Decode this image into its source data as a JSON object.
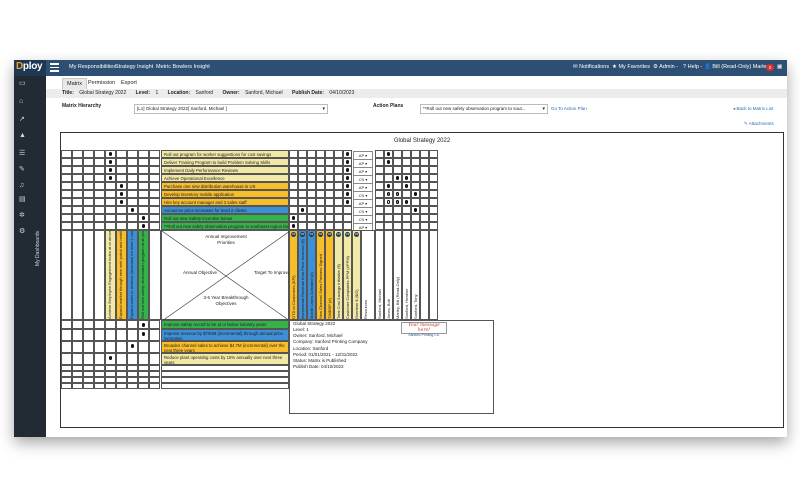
{
  "app": {
    "logo": {
      "part1": "D",
      "part2": "ploy"
    },
    "nav": [
      "My Responsibilities",
      "Strategy Insight",
      "Metric Bowlers Insight"
    ],
    "right": {
      "notifications": "Notifications",
      "favorites": "My Favorites",
      "admin": "Admin -",
      "help": "Help -",
      "user": "Bill (Read-Only) Marley",
      "count": "0"
    }
  },
  "sidebar": {
    "label": "My Dashboards"
  },
  "tabs": [
    "Matrix",
    "Permission",
    "Export"
  ],
  "info": {
    "title_label": "Title:",
    "title": "Global Strategy 2022",
    "level_label": "Level:",
    "level": "1",
    "location_label": "Location:",
    "location": "Sanford",
    "owner_label": "Owner:",
    "owner": "Sanford, Michael",
    "publish_label": "Publish Date:",
    "publish": "04/10/2023"
  },
  "hierarchy": {
    "label": "Matrix Hierarchy",
    "value": "[L1] Global Strategy 2022[ Sanford, Michael ]"
  },
  "actionplans": {
    "label": "Action Plans",
    "value": "**Roll out new safety observation program to sout...",
    "goto": "Go To Action Plan"
  },
  "links": {
    "back": "Back to Matrix List",
    "attachments": "Attachments"
  },
  "matrix": {
    "title": "Global Strategy 2022",
    "strategies": [
      {
        "text": "Roll out program for worker suggestions for cost savings",
        "color": "#f3e9a6"
      },
      {
        "text": "Deliver Training Program to build Problem Solving Skills",
        "color": "#f3e9a6"
      },
      {
        "text": "Implement Daily Performance Reviews",
        "color": "#f3e9a6"
      },
      {
        "text": "Achieve Operational Excellence",
        "color": "#f3e9a6"
      },
      {
        "text": "Purchase one new distribution warehouse in US",
        "color": "#f7bd2a"
      },
      {
        "text": "Develop inventory mobile application",
        "color": "#f7bd2a"
      },
      {
        "text": "Hire key account manager and 3 sales staff",
        "color": "#f7bd2a"
      },
      {
        "text": "Announce price increases for level 2 clients",
        "color": "#3d8fd6"
      },
      {
        "text": "Roll out new Safety Incentive bonus",
        "color": "#36b24a"
      },
      {
        "text": "**Roll out new safety observation program to southeast region facilities",
        "color": "#36b24a"
      }
    ],
    "owners": [
      "AP",
      "AP",
      "AP",
      "CS",
      "AP",
      "CS",
      "AP",
      "CS",
      "CS",
      "AP"
    ],
    "tactics": [
      {
        "text": "Achieve Employee Engagement Index at or above the High Performer Benchmark Avg (Mean 4.5)",
        "color": "#f3e9a6"
      },
      {
        "text": "Expand market through new web portal and mobile application",
        "color": "#f7bd2a"
      },
      {
        "text": "Expand sales to achieve (increase) for level 2 customers",
        "color": "#3d8fd6"
      },
      {
        "text": "Roll out new safety observation program at all plants",
        "color": "#36b24a"
      }
    ],
    "center": {
      "top": "Annual Improvement Priorities",
      "left": "Annual Objective",
      "right": "Target To Improve",
      "bottom": "3-5 Year Breakthrough Objectives"
    },
    "kpis": [
      {
        "text": "OTD to Customers (KPI)",
        "color": "#f7bd2a"
      },
      {
        "text": "Incremental Revenue from Price Increase ($)",
        "color": "#3d8fd6"
      },
      {
        "text": "Mobile Users Activated (#)",
        "color": "#3d8fd6"
      },
      {
        "text": "New Channel Sales Partners Signed",
        "color": "#f7bd2a"
      },
      {
        "text": "TIMBSP (#)",
        "color": "#f7bd2a"
      },
      {
        "text": "Total Cost Savings Initiative ($)",
        "color": "#f3e9a6"
      },
      {
        "text": "Customer Complaints PPM (#PPM)",
        "color": "#f3e9a6"
      },
      {
        "text": "Overtime $ ($/D)",
        "color": "#f3e9a6"
      }
    ],
    "resources_label": "Resources",
    "resources": [
      "Sanford, Michael",
      "Jones, Bob",
      "Marley, Bill (Read-Only)",
      "Sanford, Heather",
      "Sanford, Tony"
    ],
    "objectives": [
      {
        "text": "Improve safety record to be at or below industry years",
        "color": "#36b24a"
      },
      {
        "text": "Improve revenue by $750M (incremental) through annual price increases",
        "color": "#3d8fd6"
      },
      {
        "text": "Broaden channel sales to achieve $4.7M (incremental) over the next three years",
        "color": "#f7bd2a"
      },
      {
        "text": "Reduce plant operating costs by 15% annually over next three years",
        "color": "#f3e9a6"
      }
    ],
    "summary": {
      "title": "Global Strategy 2022",
      "lines": [
        "Level: 1",
        "Owner: Sanford, Michael",
        "Company: Sanford Printing Company",
        "Location: Sanford",
        "Period: 01/01/2021 - 12/31/2022",
        "Status: Matrix is Published",
        "Publish Date: 04/10/2023"
      ]
    },
    "stamp": {
      "script": "Your message here!",
      "company": "Sanford Printing Co."
    }
  }
}
